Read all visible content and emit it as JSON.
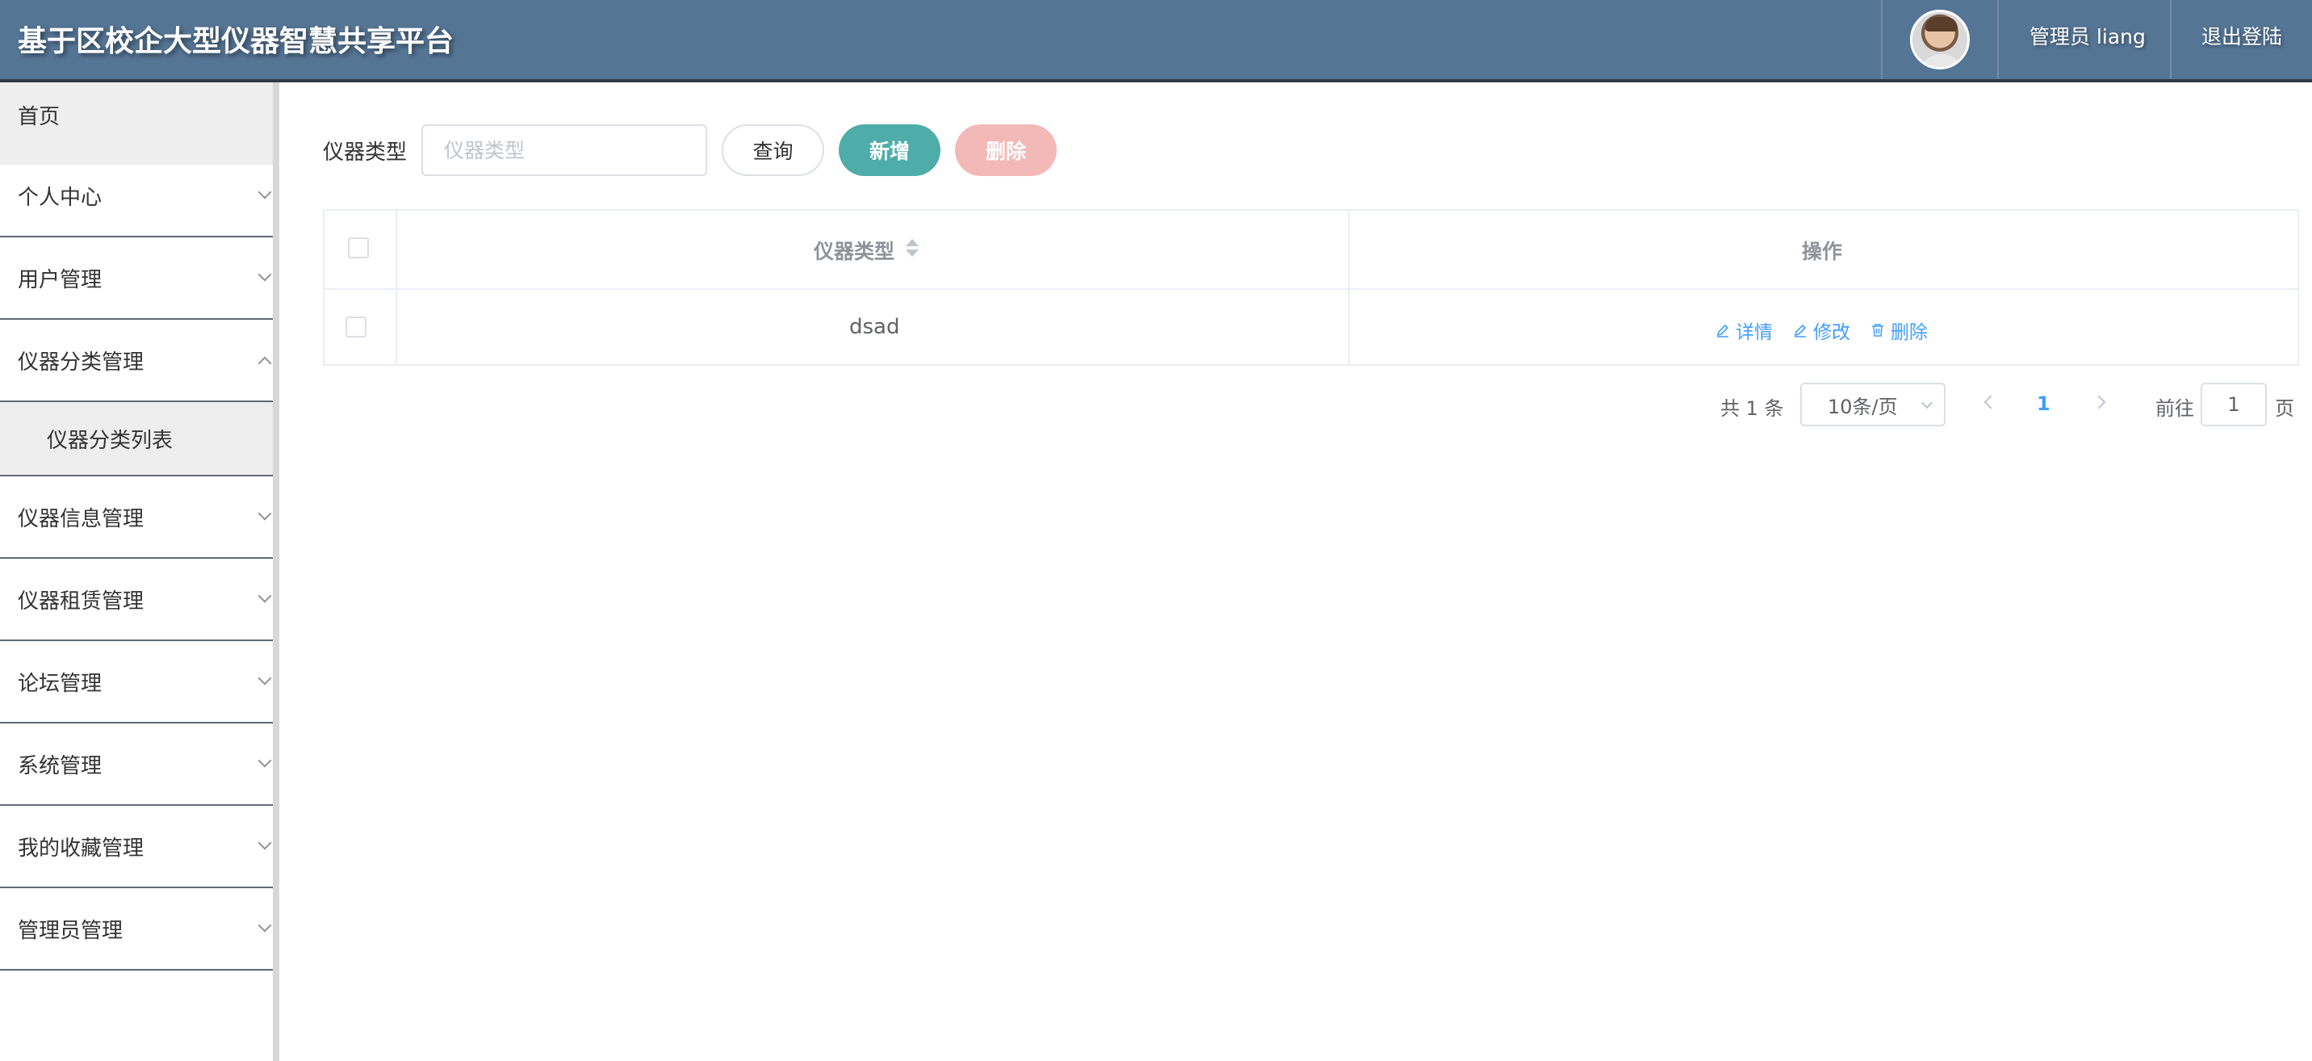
{
  "header": {
    "title": "基于区校企大型仪器智慧共享平台",
    "admin": "管理员 liang",
    "logout": "退出登陆",
    "avatar": "avatar-icon"
  },
  "sidebar": {
    "items": [
      {
        "label": "首页"
      },
      {
        "label": "个人中心"
      },
      {
        "label": "用户管理"
      },
      {
        "label": "仪器分类管理"
      },
      {
        "label": "仪器分类列表"
      },
      {
        "label": "仪器信息管理"
      },
      {
        "label": "仪器租赁管理"
      },
      {
        "label": "论坛管理"
      },
      {
        "label": "系统管理"
      },
      {
        "label": "我的收藏管理"
      },
      {
        "label": "管理员管理"
      }
    ]
  },
  "search": {
    "label": "仪器类型",
    "placeholder": "仪器类型",
    "value": "",
    "query_btn": "查询",
    "add_btn": "新增",
    "delete_btn": "删除"
  },
  "table": {
    "columns": [
      "仪器类型",
      "操作"
    ],
    "rows": [
      {
        "type": "dsad"
      }
    ],
    "actions": {
      "detail": "详情",
      "edit": "修改",
      "delete": "删除"
    }
  },
  "pagination": {
    "total": "共 1 条",
    "page_size": "10条/页",
    "current": "1",
    "goto_label": "前往",
    "goto_value": "1",
    "page_suffix": "页"
  },
  "colors": {
    "header_bg": "#557595",
    "add_btn": "#4fada9",
    "delete_btn": "#f3b8b8",
    "link": "#409eff"
  }
}
